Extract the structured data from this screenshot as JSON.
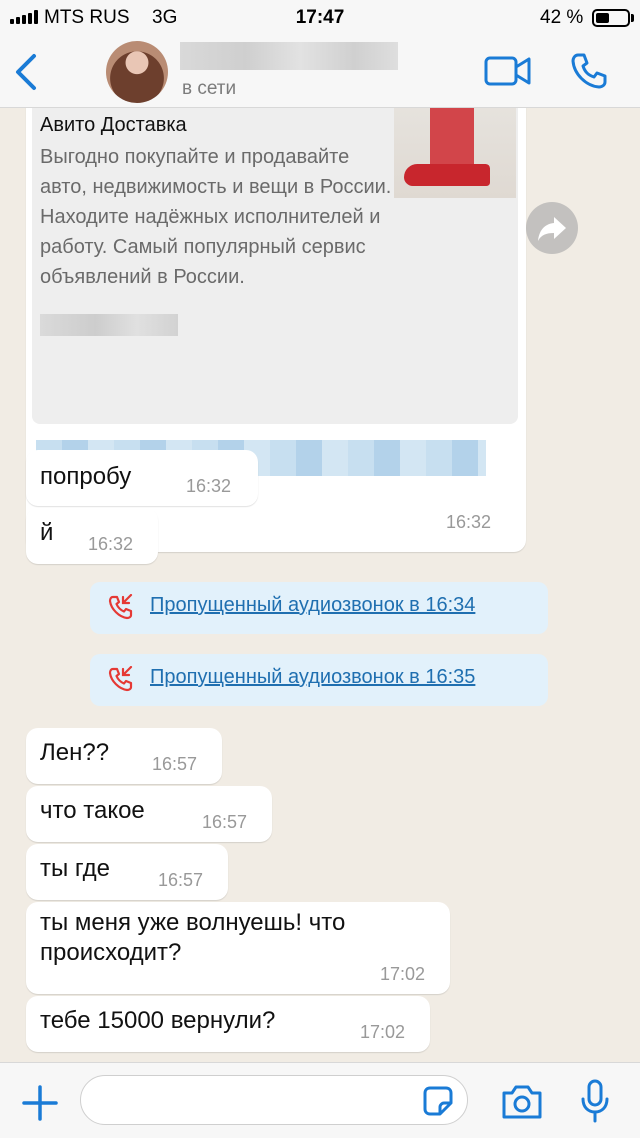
{
  "status_bar": {
    "carrier": "MTS RUS",
    "network": "3G",
    "time": "17:47",
    "battery": "42 %",
    "battery_level": 0.42
  },
  "header": {
    "contact_status": "в сети",
    "back_icon": "chevron-left-icon",
    "video_icon": "video-camera-icon",
    "call_icon": "phone-icon"
  },
  "messages": [
    {
      "type": "link",
      "preview_title": "Авито Доставка",
      "preview_description": "Выгодно покупайте и продавайте авто, недвижимость и вещи в России. Находите надёжных исполнителей и работу. Самый популярный сервис объявлений в России.",
      "time": "16:32"
    },
    {
      "text": "попробу",
      "time": "16:32"
    },
    {
      "text": "й",
      "time": "16:32"
    },
    {
      "type": "missed_call",
      "text": "Пропущенный аудиозвонок в 16:34"
    },
    {
      "type": "missed_call",
      "text": "Пропущенный аудиозвонок в 16:35"
    },
    {
      "text": "Лен??",
      "time": "16:57"
    },
    {
      "text": "что такое",
      "time": "16:57"
    },
    {
      "text": "ты где",
      "time": "16:57"
    },
    {
      "text": "ты меня уже волнуешь! что происходит?",
      "time": "17:02"
    },
    {
      "text": "тебе 15000 вернули?",
      "time": "17:02"
    }
  ],
  "input_bar": {
    "placeholder": "",
    "icons": [
      "plus-icon",
      "sticker-icon",
      "camera-icon",
      "microphone-icon"
    ]
  },
  "colors": {
    "accent": "#1a7bd6",
    "chat_background": "#f1ece4",
    "bubble": "#ffffff",
    "call_bubble": "#e2f1fb",
    "missed_call_icon": "#e53935"
  }
}
